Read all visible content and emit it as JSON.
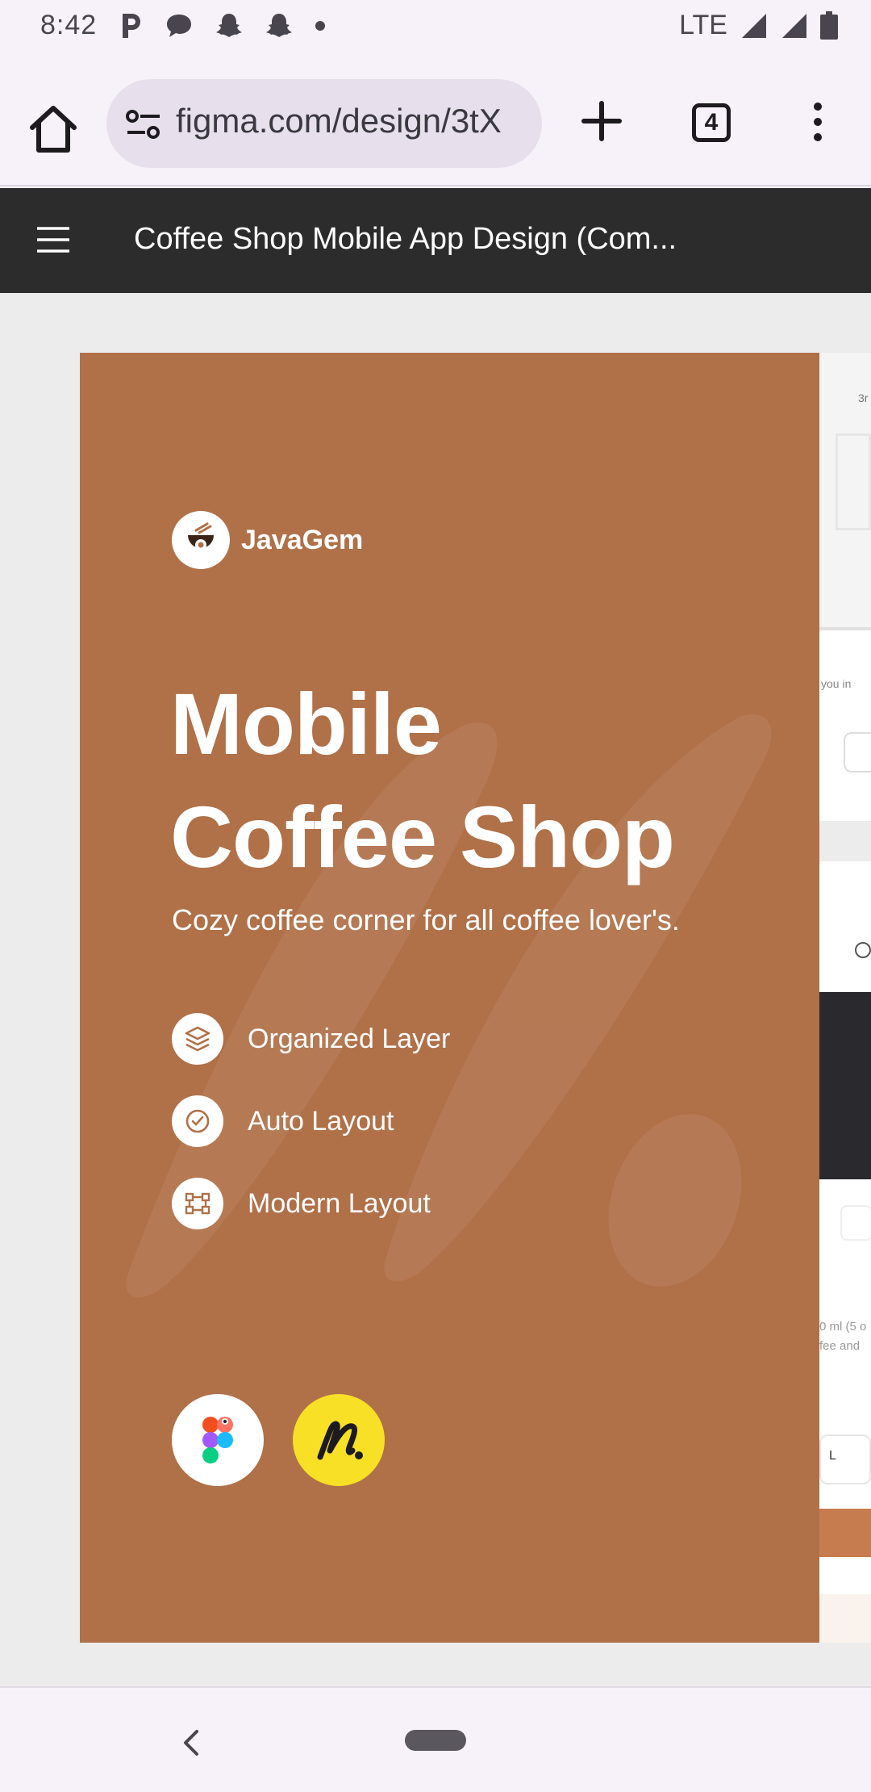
{
  "status_bar": {
    "time": "8:42",
    "network": "LTE",
    "notification_icons": [
      "parking-icon",
      "chat-bubble-icon",
      "snapchat-icon",
      "snapchat-icon",
      "dot-icon"
    ]
  },
  "browser": {
    "url": "figma.com/design/3tX",
    "tab_count": "4"
  },
  "figma": {
    "file_title": "Coffee Shop Mobile App Design (Com..."
  },
  "frame": {
    "brand_name": "JavaGem",
    "hero_line1": "Mobile",
    "hero_line2": "Coffee Shop",
    "subtitle": "Cozy coffee corner for all coffee lover's.",
    "features": [
      {
        "label": "Organized Layer",
        "icon": "layers-icon"
      },
      {
        "label": "Auto Layout",
        "icon": "check-circle-icon"
      },
      {
        "label": "Modern Layout",
        "icon": "components-icon"
      }
    ],
    "tools": [
      "figma-icon",
      "noun-project-icon"
    ],
    "colors": {
      "background": "#b07048",
      "tool_yellow": "#f8e027"
    }
  },
  "peek_frame": {
    "texts": [
      "3r",
      "you in",
      "0 ml (5 o",
      "fee and",
      "L"
    ]
  }
}
